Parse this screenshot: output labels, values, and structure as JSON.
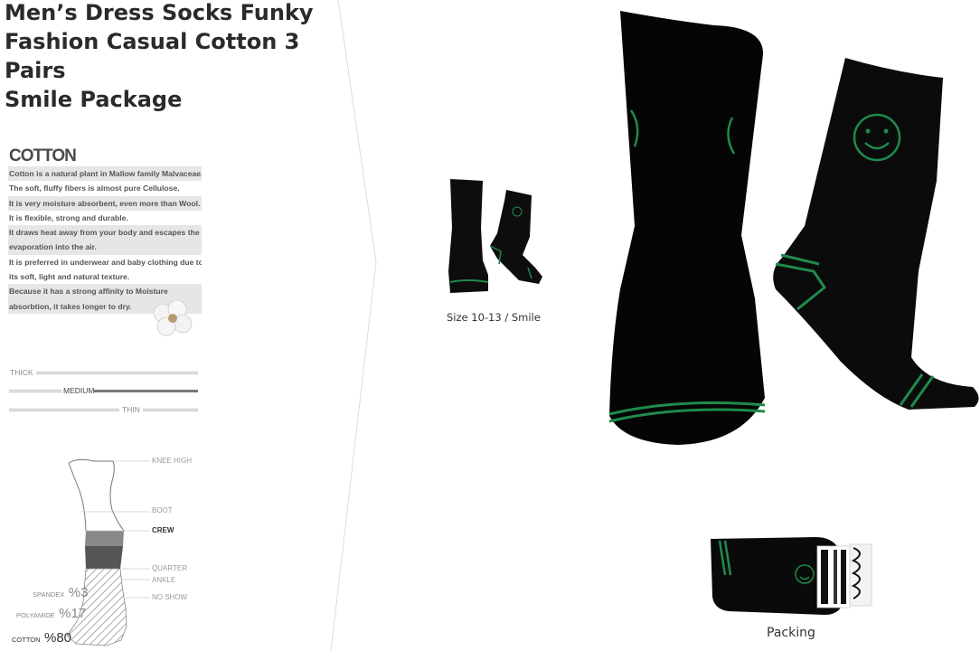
{
  "product": {
    "title_lines": [
      "Men’s Dress Socks Funky",
      "Fashion Casual Cotton 3 Pairs",
      "Smile Package"
    ]
  },
  "cotton": {
    "heading": "COTTON",
    "lines": [
      "Cotton is a natural plant in Mallow family Malvaceae.",
      "The soft, fluffy fibers is almost pure Cellulose.",
      "It is very  moisture absorbent, even more than Wool.",
      "It is flexible, strong and durable.",
      "It draws heat away from your body and escapes the",
      "evaporation  into the air.",
      "It is preferred in underwear and baby clothing due to",
      "its soft, light and natural texture.",
      "Because  it has a strong affinity to Moisture",
      "absorbtion, it takes longer to dry."
    ]
  },
  "thickness": {
    "labels": [
      "THICK",
      "MEDIUM",
      "THIN"
    ],
    "selected": "MEDIUM"
  },
  "length": {
    "labels": [
      "KNEE HIGH",
      "BOOT",
      "CREW",
      "QUARTER",
      "ANKLE",
      "NO SHOW"
    ],
    "selected": "CREW"
  },
  "composition": [
    {
      "name": "SPANDEX",
      "value": "%3"
    },
    {
      "name": "POLYAMIDE",
      "value": "%17"
    },
    {
      "name": "COTTON",
      "value": "%80"
    }
  ],
  "thumbnail": {
    "caption": "Size 10-13 / Smile"
  },
  "packing": {
    "caption": "Packing"
  },
  "colors": {
    "sock": "#0c0c0c",
    "stripe": "#1f8a4c",
    "panel_text": "#555555"
  }
}
